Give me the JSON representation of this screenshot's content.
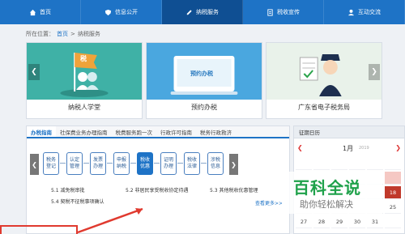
{
  "nav": {
    "items": [
      {
        "label": "首页",
        "icon": "home-icon"
      },
      {
        "label": "信息公开",
        "icon": "shield-icon"
      },
      {
        "label": "纳税服务",
        "icon": "pen-icon",
        "active": true
      },
      {
        "label": "税收宣传",
        "icon": "document-icon"
      },
      {
        "label": "互动交流",
        "icon": "user-icon"
      }
    ]
  },
  "breadcrumb": {
    "prefix": "所在位置：",
    "home": "首页",
    "sep": ">",
    "current": "纳税服务"
  },
  "cards": [
    {
      "caption": "纳税人学堂",
      "badge": "税",
      "bg": "#3fb1a6"
    },
    {
      "caption": "预约办税",
      "badge": "预约办税",
      "bg": "#4aa7df"
    },
    {
      "caption": "广东省电子税务局",
      "bg": "#e9f2ea"
    }
  ],
  "tabs": [
    "办税指南",
    "社保费业务办理指南",
    "税费服务跑一次",
    "行政许可指南",
    "税务行政救济"
  ],
  "steps": [
    "税务登记",
    "认定管理",
    "发票办理",
    "申报纳税",
    "税收优惠",
    "证明办理",
    "税收法律",
    "涉税信息"
  ],
  "links": [
    "5.1 减免税审批",
    "5.2 非居民享受税收协定待遇",
    "5.3 其他税收优惠管理",
    "5.4 契税不征税事项确认"
  ],
  "more": "查看更多>>",
  "calendar": {
    "title": "征期日历",
    "month": "1月",
    "year": "2019",
    "rows": [
      [
        "",
        "",
        "",
        "",
        "",
        ""
      ],
      [
        "",
        "",
        "",
        "",
        "",
        ""
      ],
      [
        "",
        "",
        "",
        "",
        "",
        "18"
      ],
      [
        "",
        "",
        "",
        "",
        "",
        "25"
      ],
      [
        "27",
        "28",
        "29",
        "30",
        "31",
        ""
      ]
    ]
  },
  "watermark": {
    "title": "百科全说",
    "subtitle": "助你轻松解决"
  },
  "colors": {
    "nav": "#1e73c6",
    "nav_active": "#0f4f93",
    "highlight": "#e03a2f",
    "watermark": "#1ea14a"
  }
}
